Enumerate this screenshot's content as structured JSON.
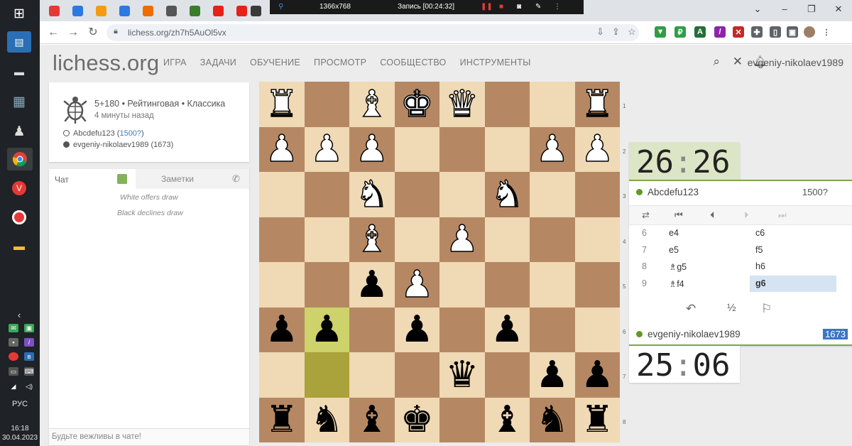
{
  "recorder": {
    "resolution": "1366x768",
    "status": "Запись [00:24:32]"
  },
  "browser": {
    "url": "lichess.org/zh7h5AuOl5vx",
    "tabs": [
      {
        "icon": "yandex-icon",
        "color": "#e53935"
      },
      {
        "icon": "mail-icon",
        "color": "#2a7ae2"
      },
      {
        "icon": "ok-icon",
        "color": "#f39c12"
      },
      {
        "icon": "messenger-icon",
        "color": "#2a7ae2"
      },
      {
        "icon": "pie-icon",
        "color": "#ef6c00"
      },
      {
        "icon": "speaker-icon",
        "color": "#555555"
      },
      {
        "icon": "chess-icon",
        "color": "#3a7d2a"
      },
      {
        "icon": "youtube-icon",
        "color": "#e62117"
      },
      {
        "icon": "youtube-icon",
        "color": "#e62117"
      }
    ]
  },
  "site": {
    "logo": "lichess",
    "logo_tld": ".org",
    "nav": [
      "ИГРА",
      "ЗАДАЧИ",
      "ОБУЧЕНИЕ",
      "ПРОСМОТР",
      "СООБЩЕСТВО",
      "ИНСТРУМЕНТЫ"
    ],
    "username": "evgeniy-nikolaev1989"
  },
  "game": {
    "type": "5+180 • Рейтинговая • Классика",
    "time_ago": "4 минуты назад",
    "white_name": "Abcdefu123",
    "white_rating": "1500?",
    "black_name": "evgeniy-nikolaev1989",
    "black_rating": "(1673)"
  },
  "chat": {
    "tab_label": "Чат",
    "notes_label": "Заметки",
    "messages": [
      "White offers draw",
      "Black declines draw"
    ],
    "placeholder": "Будьте вежливы в чате!"
  },
  "board": {
    "orientation": "black",
    "rank_labels": [
      "1",
      "2",
      "3",
      "4",
      "5",
      "6",
      "7",
      "8"
    ],
    "rows": [
      [
        "wR",
        "",
        "wB",
        "wK",
        "wQ",
        "",
        "",
        "wR"
      ],
      [
        "wP",
        "wP",
        "wP",
        "",
        "",
        "",
        "wP",
        "wP"
      ],
      [
        "",
        "",
        "wN",
        "",
        "",
        "wN",
        "",
        ""
      ],
      [
        "",
        "",
        "wB",
        "",
        "wP",
        "",
        "",
        ""
      ],
      [
        "",
        "",
        "bP",
        "wP",
        "",
        "",
        "",
        ""
      ],
      [
        "bP",
        "bP",
        "",
        "bP",
        "",
        "bP",
        "",
        ""
      ],
      [
        "",
        "",
        "",
        "",
        "bQ",
        "",
        "bP",
        "bP"
      ],
      [
        "bR",
        "bN",
        "bB",
        "bK",
        "",
        "bB",
        "bN",
        "bR"
      ]
    ],
    "highlight": [
      [
        5,
        1
      ],
      [
        6,
        1
      ]
    ]
  },
  "clocks": {
    "top": {
      "min": "26",
      "sec": "26"
    },
    "bottom": {
      "min": "25",
      "sec": "06"
    }
  },
  "panel": {
    "top_player": "Abcdefu123",
    "top_rating": "1500?",
    "bottom_player": "evgeniy-nikolaev1989",
    "bottom_rating": "1673",
    "moves": [
      {
        "num": "6",
        "white": "e4",
        "black": "c6"
      },
      {
        "num": "7",
        "white": "e5",
        "black": "f5"
      },
      {
        "num": "8",
        "white": "♗g5",
        "black": "h6"
      },
      {
        "num": "9",
        "white": "♗f4",
        "black": "g6"
      }
    ],
    "active_move": "g6"
  },
  "taskbar": {
    "lang": "РУС",
    "time": "16:18",
    "date": "30.04.2023"
  }
}
